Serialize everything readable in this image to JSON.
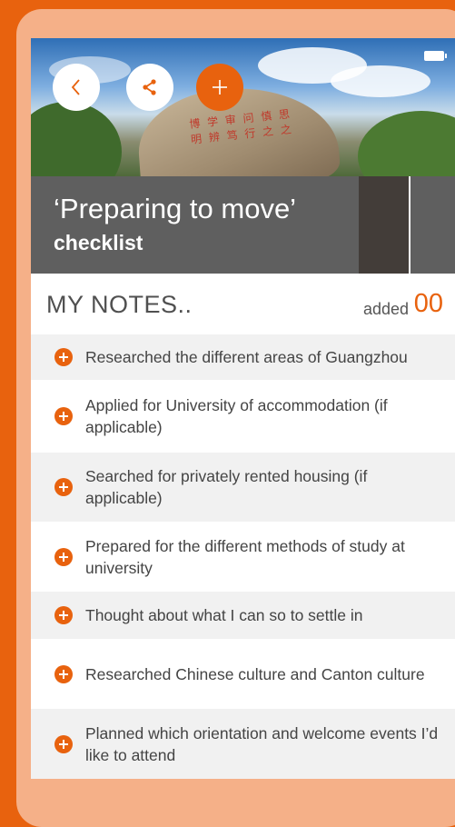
{
  "title": {
    "line1": "‘Preparing to move’",
    "line2": "checklist"
  },
  "toolbar": {
    "back_icon": "chevron-left-icon",
    "share_icon": "share-icon",
    "add_icon": "plus-icon"
  },
  "notes": {
    "heading": "MY NOTES..",
    "added_label": "added",
    "added_count": "00",
    "items": [
      {
        "text": "Researched the different areas of Guangzhou"
      },
      {
        "text": "Applied for University of accommodation (if applicable)"
      },
      {
        "text": "Searched for privately rented housing (if applicable)"
      },
      {
        "text": "Prepared for the different methods of study at university"
      },
      {
        "text": "Thought about what I can so to settle in"
      },
      {
        "text": "Researched Chinese culture and Canton culture"
      },
      {
        "text": "Planned which orientation and welcome events I’d like to attend"
      }
    ]
  },
  "colors": {
    "accent": "#e8620e",
    "frame": "#f5b088",
    "title_bg": "#5f5f5f"
  }
}
